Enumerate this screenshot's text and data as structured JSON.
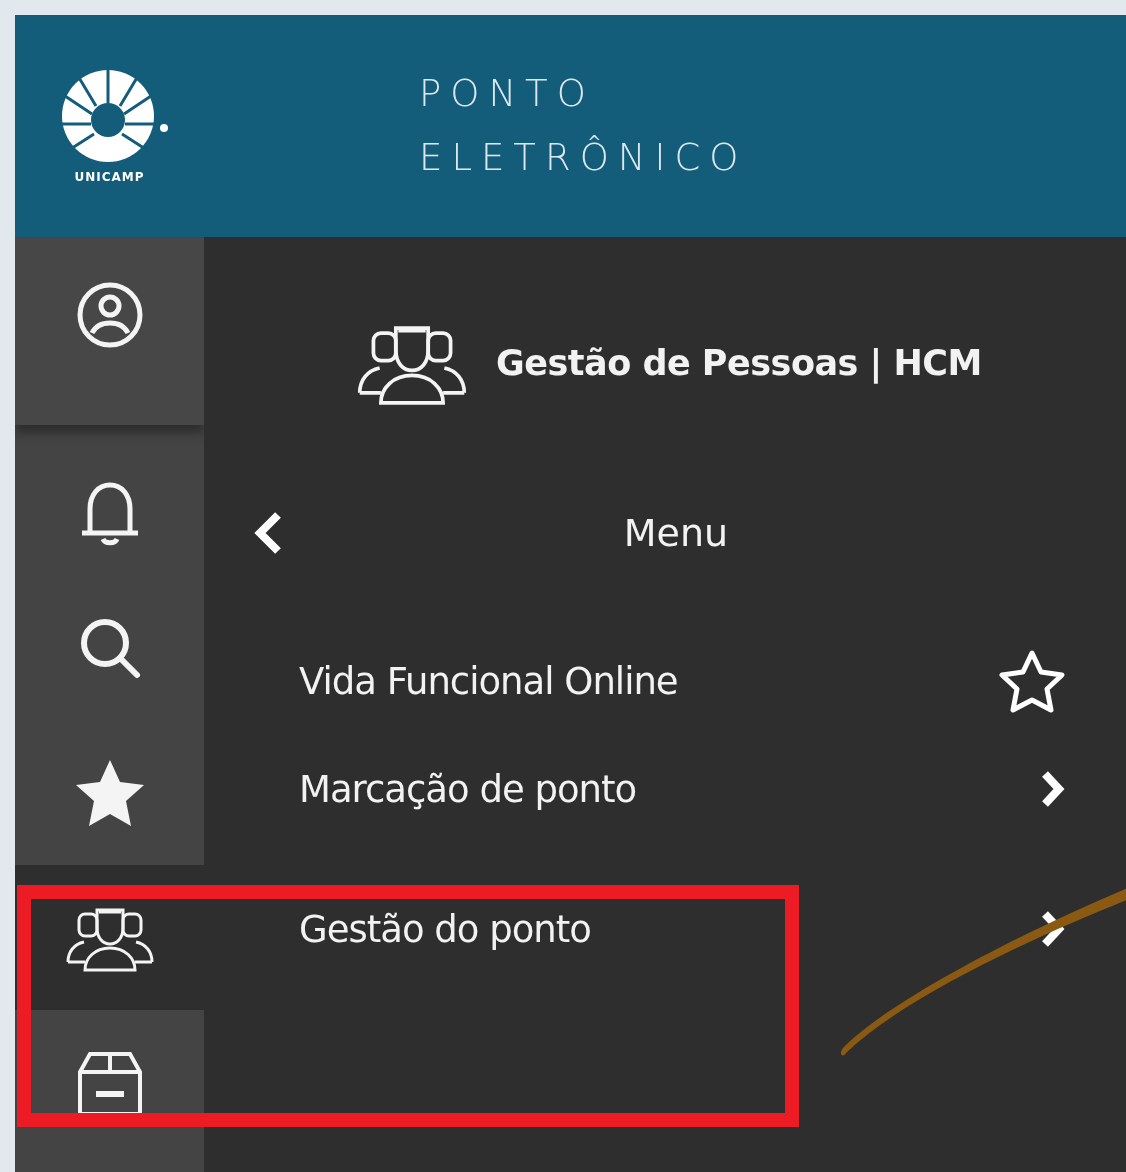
{
  "header": {
    "logo_text": "UNICAMP",
    "title_lines": [
      "PONTO",
      "ELETRÔNICO"
    ]
  },
  "sidebar": {
    "items": [
      {
        "kind": "profile",
        "selected": false
      },
      {
        "kind": "notifications",
        "selected": false
      },
      {
        "kind": "search",
        "selected": false
      },
      {
        "kind": "favorites",
        "selected": false
      },
      {
        "kind": "people",
        "selected": true
      },
      {
        "kind": "box",
        "selected": false
      }
    ]
  },
  "panel": {
    "module_title": "Gestão de Pessoas | HCM",
    "menu_title": "Menu",
    "items": [
      {
        "label": "Vida Funcional Online",
        "kind": "favorite",
        "favorited": false
      },
      {
        "label": "Marcação de ponto",
        "kind": "submenu"
      },
      {
        "label": "Gestão do ponto",
        "kind": "submenu"
      }
    ]
  }
}
